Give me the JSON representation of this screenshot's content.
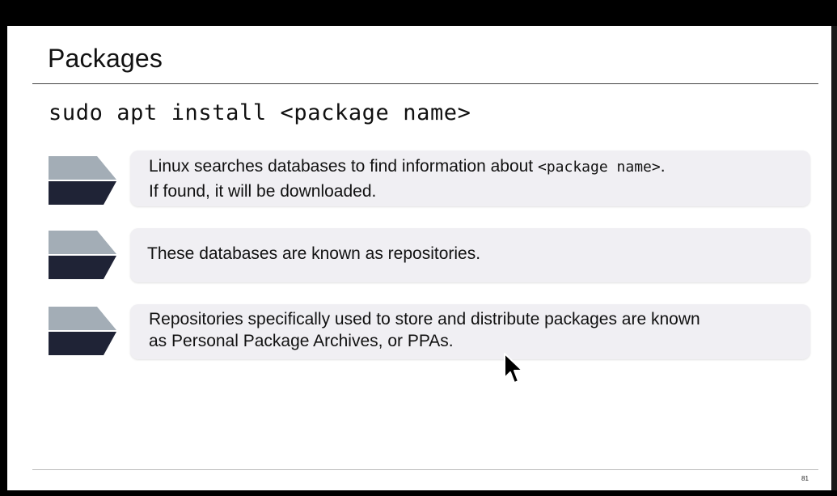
{
  "slide": {
    "title": "Packages",
    "command": "sudo apt install <package name>",
    "points": [
      {
        "line1_pre": "Linux searches databases to find information about ",
        "line1_code": "<package name>",
        "line1_post": ".",
        "line2": "If found, it will be downloaded."
      },
      {
        "line1": "These databases are known as repositories."
      },
      {
        "line1": "Repositories specifically used to store and distribute packages are known",
        "line2": "as Personal Package Archives, or PPAs."
      }
    ],
    "page_number": "81"
  },
  "colors": {
    "bullet_top": "#a3adb6",
    "bullet_bottom": "#1f2336",
    "card_bg": "#f0eff3",
    "slide_bg": "#ffffff",
    "frame_bg": "#000000"
  },
  "icons": {
    "bullet": "chevron-arrow-icon",
    "cursor": "mouse-pointer-icon"
  }
}
